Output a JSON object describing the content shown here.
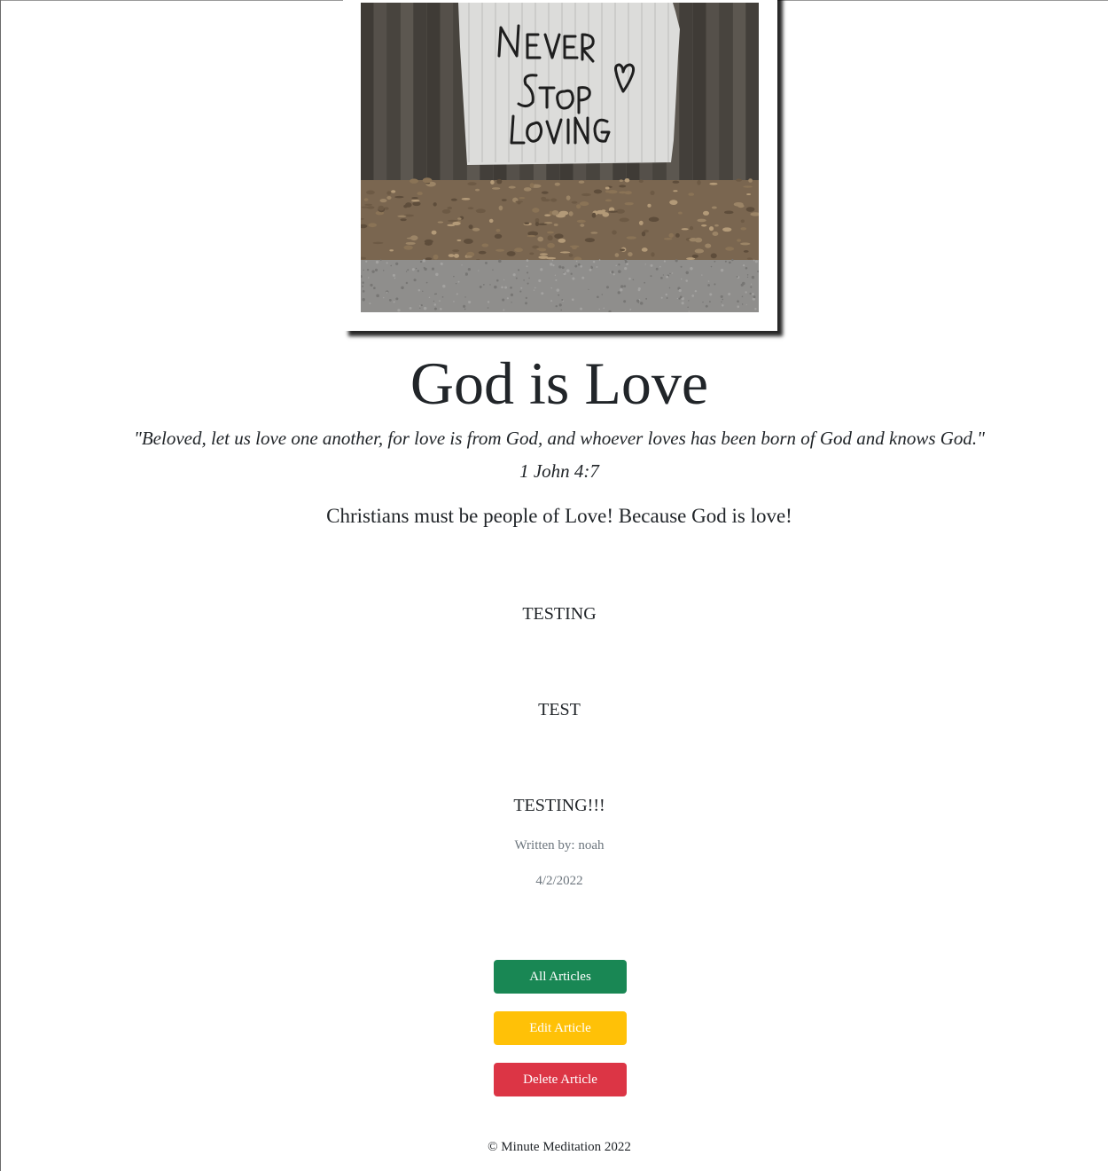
{
  "article": {
    "image_alt_text": "NEVER STOP LOVING",
    "title": "God is Love",
    "verse_quote": "\"Beloved, let us love one another, for love is from God, and whoever loves has been born of God and knows God.\"",
    "verse_reference": "1 John 4:7",
    "summary": "Christians must be people of Love! Because God is love!",
    "paragraphs": [
      "TESTING",
      "TEST",
      "TESTING!!!"
    ],
    "author_line": "Written by: noah",
    "date": "4/2/2022"
  },
  "actions": {
    "all_articles_label": "All Articles",
    "edit_article_label": "Edit Article",
    "delete_article_label": "Delete Article"
  },
  "footer": {
    "copyright": "© Minute Meditation 2022"
  },
  "colors": {
    "success": "#198754",
    "warning": "#ffc107",
    "danger": "#dc3545",
    "text": "#212529",
    "muted": "#6c757d"
  }
}
